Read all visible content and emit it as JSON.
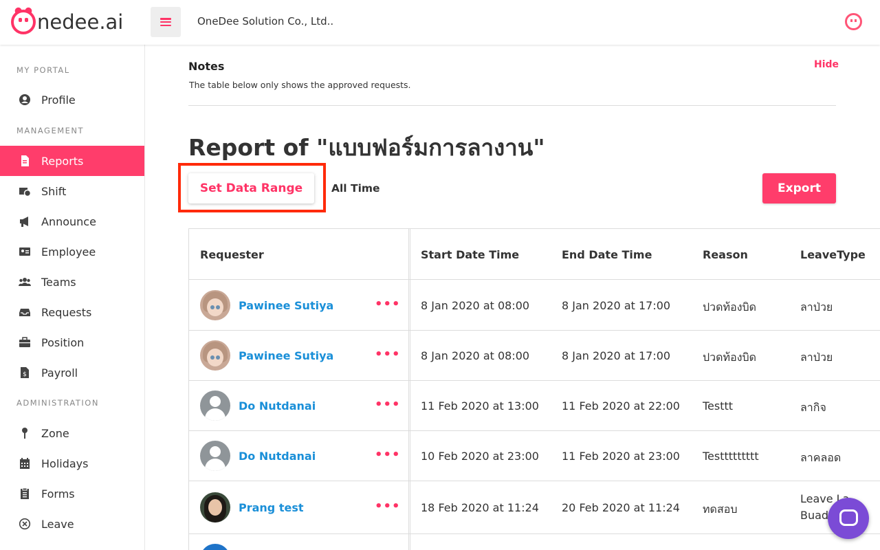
{
  "header": {
    "logo_text": "nedee.ai",
    "company": "OneDee Solution Co., Ltd..",
    "brand_color": "#ff3366"
  },
  "sidebar": {
    "sections": [
      {
        "title": "MY PORTAL",
        "items": [
          {
            "label": "Profile",
            "icon": "user-circle-icon"
          }
        ]
      },
      {
        "title": "MANAGEMENT",
        "items": [
          {
            "label": "Reports",
            "icon": "document-icon",
            "active": true
          },
          {
            "label": "Shift",
            "icon": "shift-icon"
          },
          {
            "label": "Announce",
            "icon": "megaphone-icon"
          },
          {
            "label": "Employee",
            "icon": "id-card-icon"
          },
          {
            "label": "Teams",
            "icon": "users-icon"
          },
          {
            "label": "Requests",
            "icon": "inbox-icon"
          },
          {
            "label": "Position",
            "icon": "briefcase-icon"
          },
          {
            "label": "Payroll",
            "icon": "payroll-icon"
          }
        ]
      },
      {
        "title": "ADMINISTRATION",
        "items": [
          {
            "label": "Zone",
            "icon": "map-pin-icon"
          },
          {
            "label": "Holidays",
            "icon": "calendar-icon"
          },
          {
            "label": "Forms",
            "icon": "clipboard-icon"
          },
          {
            "label": "Leave",
            "icon": "circle-x-icon"
          }
        ]
      }
    ]
  },
  "notes": {
    "title": "Notes",
    "hide_label": "Hide",
    "text": "The table below only shows the approved requests."
  },
  "report": {
    "title": "Report of \"แบบฟอร์มการลางาน\"",
    "set_range_label": "Set Data Range",
    "range_value": "All Time",
    "export_label": "Export"
  },
  "table": {
    "columns": [
      "Requester",
      "Start Date Time",
      "End Date Time",
      "Reason",
      "LeaveType"
    ],
    "rows": [
      {
        "name": "Pawinee Sutiya",
        "avatar": "doll",
        "start": "8 Jan 2020 at 08:00",
        "end": "8 Jan 2020 at 17:00",
        "reason": "ปวดท้องบิด",
        "type": "ลาป่วย"
      },
      {
        "name": "Pawinee Sutiya",
        "avatar": "doll",
        "start": "8 Jan 2020 at 08:00",
        "end": "8 Jan 2020 at 17:00",
        "reason": "ปวดท้องบิด",
        "type": "ลาป่วย"
      },
      {
        "name": "Do Nutdanai",
        "avatar": "generic",
        "start": "11 Feb 2020 at 13:00",
        "end": "11 Feb 2020 at 22:00",
        "reason": "Testtt",
        "type": "ลากิจ"
      },
      {
        "name": "Do Nutdanai",
        "avatar": "generic",
        "start": "10 Feb 2020 at 23:00",
        "end": "11 Feb 2020 at 23:00",
        "reason": "Testtttttttt",
        "type": "ลาคลอด"
      },
      {
        "name": "Prang test",
        "avatar": "photo",
        "start": "18 Feb 2020 at 11:24",
        "end": "20 Feb 2020 at 11:24",
        "reason": "ทดสอบ",
        "type": "Leave La Buad"
      }
    ],
    "more_icon": "more-dots-icon"
  }
}
